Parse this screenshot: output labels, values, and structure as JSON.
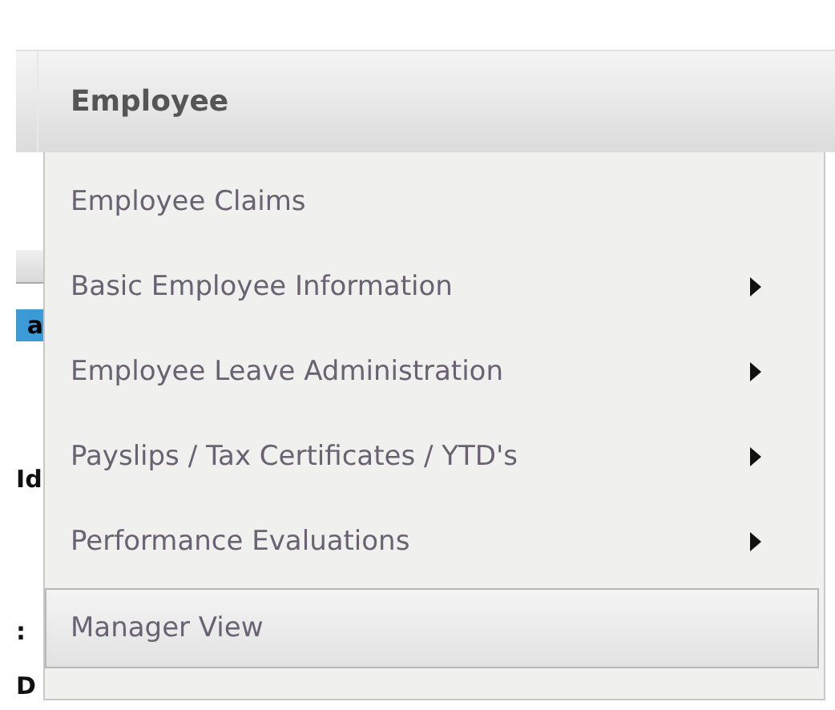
{
  "menu_bar": {
    "title": "Employee"
  },
  "background_fragments": [
    {
      "kind": "bar"
    },
    {
      "kind": "blue",
      "text": "a"
    },
    {
      "kind": "text",
      "text": "Id"
    },
    {
      "kind": "text",
      "text": ":"
    },
    {
      "kind": "text",
      "text": "D"
    }
  ],
  "menu": [
    {
      "label": "Employee Claims",
      "has_submenu": false,
      "selected": false
    },
    {
      "label": "Basic Employee Information",
      "has_submenu": true,
      "selected": false
    },
    {
      "label": "Employee Leave Administration",
      "has_submenu": true,
      "selected": false
    },
    {
      "label": "Payslips / Tax Certificates / YTD's",
      "has_submenu": true,
      "selected": false
    },
    {
      "label": "Performance Evaluations",
      "has_submenu": true,
      "selected": false
    },
    {
      "label": "Manager View",
      "has_submenu": false,
      "selected": true
    }
  ]
}
